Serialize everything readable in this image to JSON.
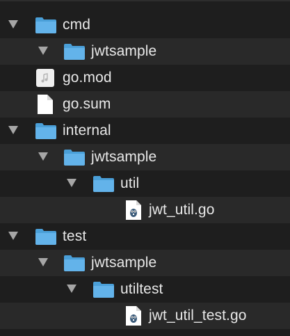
{
  "file_tree": {
    "items": [
      {
        "name": "cmd",
        "kind": "folder",
        "depth": 0,
        "expanded": true
      },
      {
        "name": "jwtsample",
        "kind": "folder",
        "depth": 1,
        "expanded": true
      },
      {
        "name": "go.mod",
        "kind": "audio-file",
        "depth": 0
      },
      {
        "name": "go.sum",
        "kind": "file",
        "depth": 0
      },
      {
        "name": "internal",
        "kind": "folder",
        "depth": 0,
        "expanded": true
      },
      {
        "name": "jwtsample",
        "kind": "folder",
        "depth": 1,
        "expanded": true
      },
      {
        "name": "util",
        "kind": "folder",
        "depth": 2,
        "expanded": true
      },
      {
        "name": "jwt_util.go",
        "kind": "go-file",
        "depth": 3
      },
      {
        "name": "test",
        "kind": "folder",
        "depth": 0,
        "expanded": true
      },
      {
        "name": "jwtsample",
        "kind": "folder",
        "depth": 1,
        "expanded": true
      },
      {
        "name": "utiltest",
        "kind": "folder",
        "depth": 2,
        "expanded": true
      },
      {
        "name": "jwt_util_test.go",
        "kind": "go-file",
        "depth": 3
      }
    ]
  },
  "colors": {
    "background": "#1e1e1e",
    "alt_row": "#292929",
    "text": "#e8e8e8",
    "disclosure": "#a6a6a6",
    "folder": "#5aaee5"
  },
  "icons": {
    "folder": "folder-icon",
    "file": "document-icon",
    "audio-file": "audio-file-icon",
    "go-file": "go-gopher-file-icon",
    "disclosure": "disclosure-triangle-icon"
  }
}
